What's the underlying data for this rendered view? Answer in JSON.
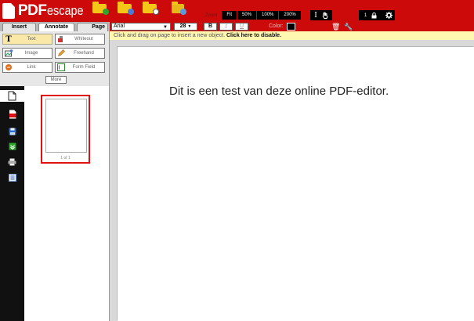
{
  "app": {
    "logo_pdf": "PDF",
    "logo_escape": "escape"
  },
  "topbar": {
    "icons": [
      "open-folder-icon",
      "upload-folder-icon",
      "recent-folder-icon",
      "share-folder-icon"
    ],
    "zoom": {
      "label": "Zoom",
      "options": [
        "Fit",
        "50%",
        "100%",
        "200%"
      ]
    },
    "cursor_tools": [
      "text-cursor-icon",
      "hand-cursor-icon"
    ],
    "page_lock": "1",
    "brand_color": "#cc0a0a"
  },
  "tabs": {
    "insert": "Insert",
    "annotate": "Annotate",
    "page": "Page"
  },
  "tools": {
    "text": "Text",
    "whiteout": "Whiteout",
    "image": "Image",
    "freehand": "Freehand",
    "link": "Link",
    "form_field": "Form Field",
    "more": "More"
  },
  "format": {
    "font": "Arial",
    "size": "28",
    "bold": "B",
    "italic": "I",
    "underline": "U",
    "color_label": "Color:",
    "color_value": "#000000"
  },
  "infobar": {
    "prefix": "Click and drag on page to insert a new object.",
    "link": "Click here to disable."
  },
  "document": {
    "text": "Dit is een test van deze online PDF-editor."
  },
  "thumbnails": {
    "label": "1 of 1"
  }
}
